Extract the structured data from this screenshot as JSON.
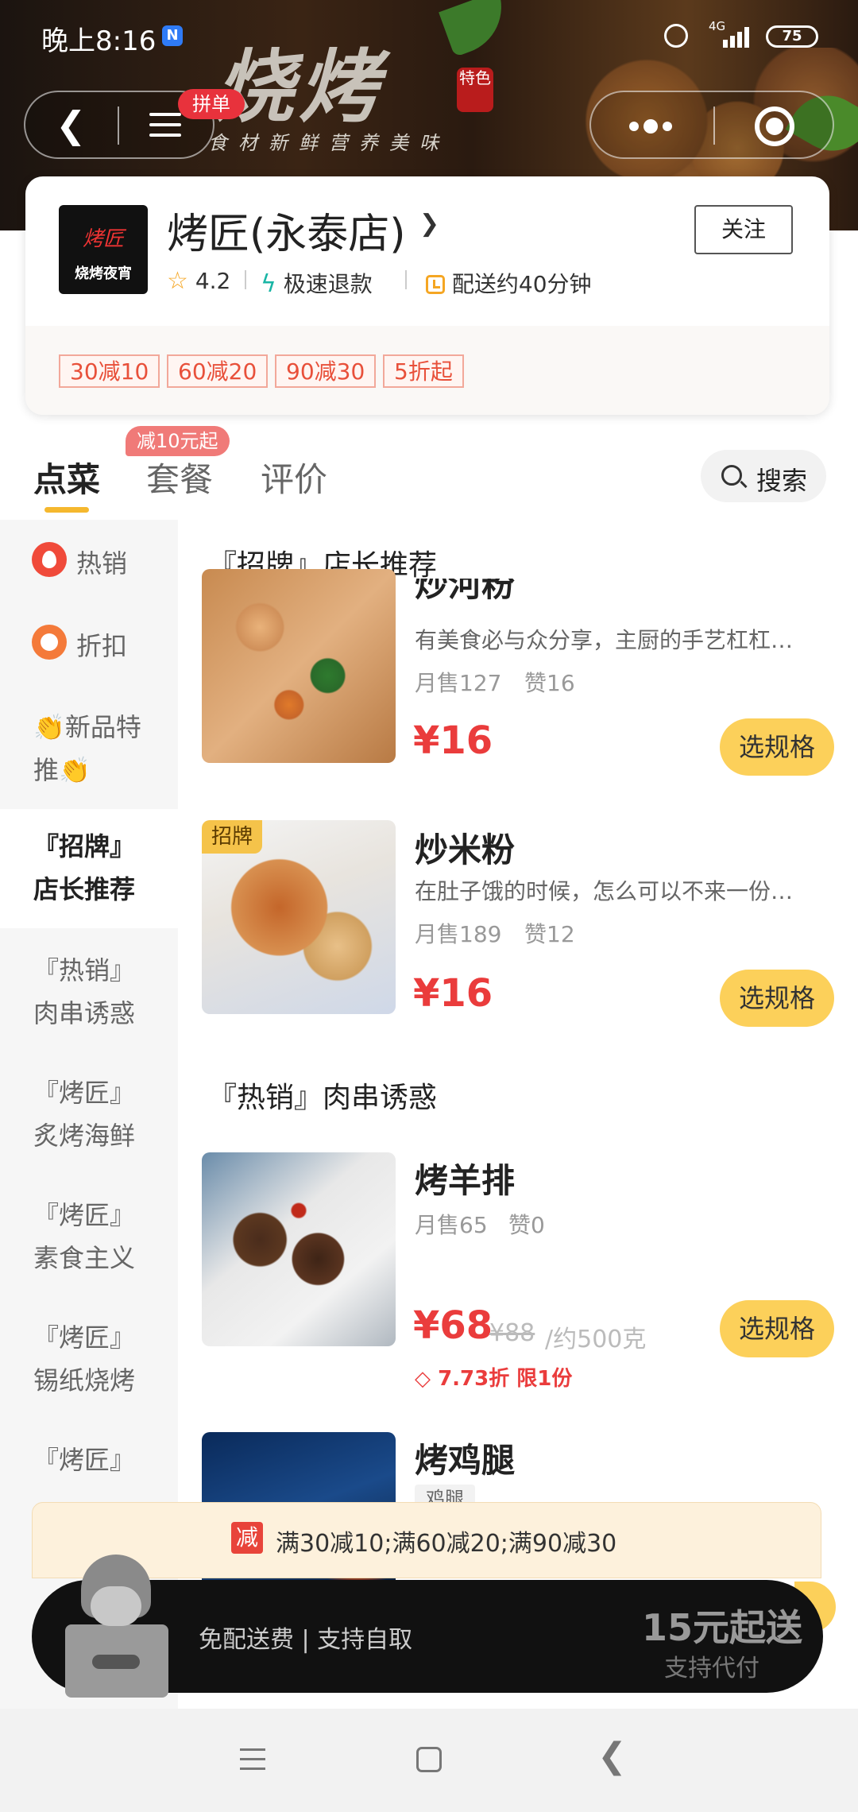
{
  "status_bar": {
    "time": "晚上8:16",
    "network": "4G",
    "battery": "75"
  },
  "banner": {
    "title": "烧烤",
    "seal": "特色",
    "slogan": "食材新鲜营养美味"
  },
  "nav": {
    "pindan_badge": "拼单"
  },
  "store": {
    "logo_line1": "烤匠",
    "logo_line2": "烧烤夜宵",
    "name": "烤匠(永泰店)",
    "follow_label": "关注",
    "rating": "4.2",
    "refund": "极速退款",
    "delivery": "配送约40分钟",
    "promos": [
      "30减10",
      "60减20",
      "90减30",
      "5折起"
    ]
  },
  "tabs": {
    "items": [
      "点菜",
      "套餐",
      "评价"
    ],
    "active": "点菜",
    "badge": "减10元起",
    "search_label": "搜索"
  },
  "sidebar": {
    "items": [
      {
        "label": "热销"
      },
      {
        "label": "折扣"
      },
      {
        "label": "👏新品特推👏",
        "line1": "👏新品特",
        "line2": "推👏"
      },
      {
        "label": "『招牌』店长推荐",
        "line1": "『招牌』",
        "line2": "店长推荐",
        "active": true
      },
      {
        "label": "『热销』肉串诱惑",
        "line1": "『热销』",
        "line2": "肉串诱惑"
      },
      {
        "label": "『烤匠』炙烤海鲜",
        "line1": "『烤匠』",
        "line2": "炙烤海鲜"
      },
      {
        "label": "『烤匠』素食主义",
        "line1": "『烤匠』",
        "line2": "素食主义"
      },
      {
        "label": "『烤匠』锡纸烧烤",
        "line1": "『烤匠』",
        "line2": "锡纸烧烤"
      },
      {
        "label": "『烤匠』",
        "line1": "『烤匠』"
      }
    ]
  },
  "sections": [
    {
      "title": "『招牌』店长推荐",
      "items": [
        {
          "name": "炒河粉",
          "desc": "有美食必与众分享，主厨的手艺杠杠…",
          "sales": "月售127",
          "likes": "赞16",
          "price": "¥16",
          "button": "选规格"
        },
        {
          "tag": "招牌",
          "name": "炒米粉",
          "desc": "在肚子饿的时候，怎么可以不来一份…",
          "sales": "月售189",
          "likes": "赞12",
          "price": "¥16",
          "button": "选规格"
        }
      ]
    },
    {
      "title": "『热销』肉串诱惑",
      "items": [
        {
          "name": "烤羊排",
          "sales": "月售65",
          "likes": "赞0",
          "price": "¥68",
          "old_price": "¥88",
          "unit": "/约500克",
          "discount": "7.73折 限1份",
          "button": "选规格"
        },
        {
          "name": "烤鸡腿",
          "mini_tag": "鸡腿"
        }
      ]
    }
  ],
  "promo_bar": {
    "icon_label": "减",
    "text": "满30减10;满60减20;满90减30"
  },
  "cart_bar": {
    "fee_text": "免配送费 | 支持自取",
    "min_order": "15元起送",
    "proxy": "支持代付"
  }
}
